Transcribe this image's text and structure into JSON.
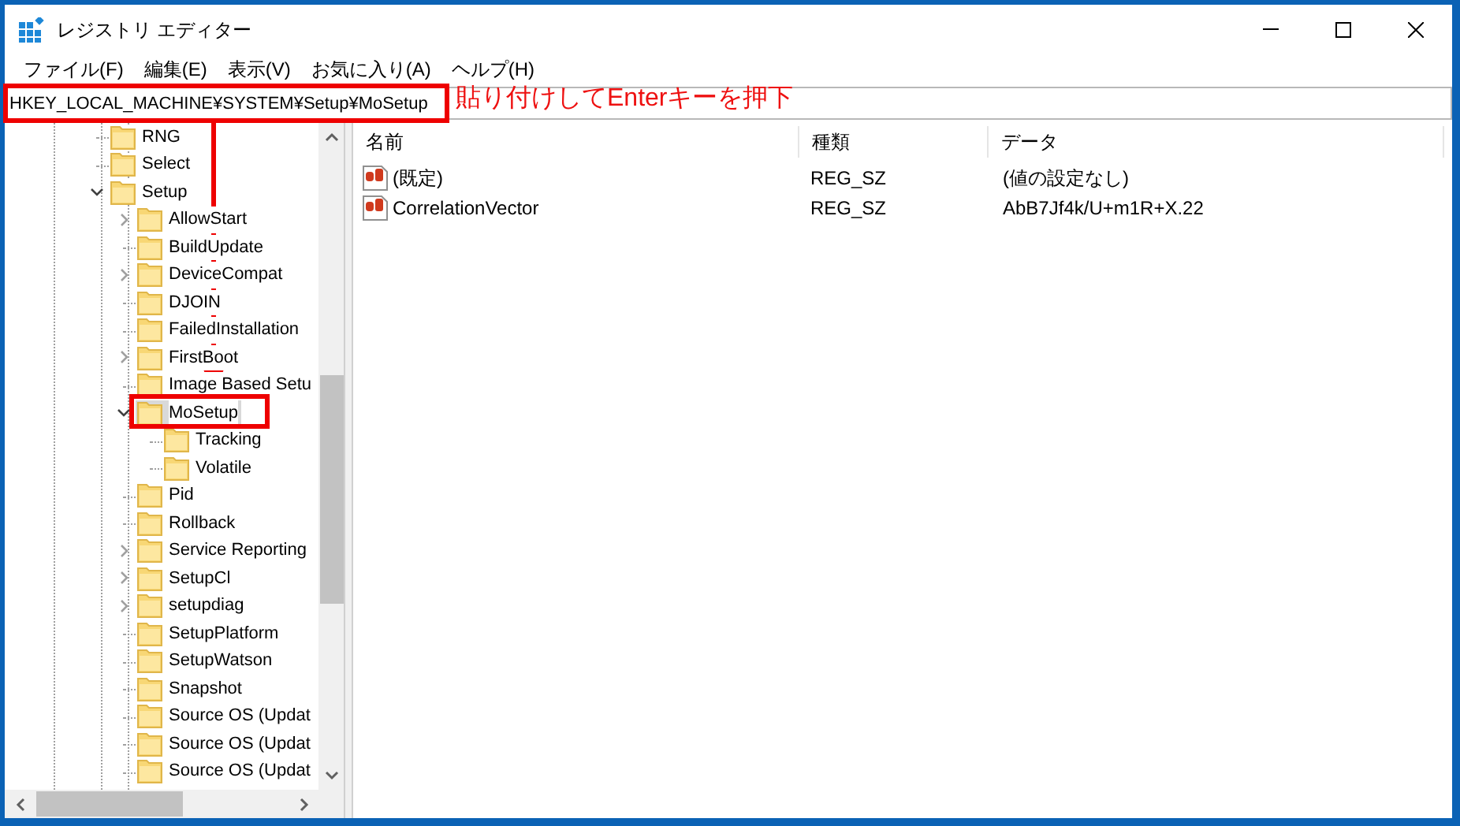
{
  "window": {
    "title": "レジストリ エディター"
  },
  "menu": [
    "ファイル(F)",
    "編集(E)",
    "表示(V)",
    "お気に入り(A)",
    "ヘルプ(H)"
  ],
  "address": "HKEY_LOCAL_MACHINE¥SYSTEM¥Setup¥MoSetup",
  "tree": [
    {
      "label": "RNG",
      "kind": "leaf",
      "selected": false
    },
    {
      "label": "Select",
      "kind": "leaf",
      "selected": false
    },
    {
      "label": "Setup",
      "kind": "expanded",
      "selected": false,
      "children": [
        {
          "label": "AllowStart",
          "kind": "collapsed",
          "selected": false
        },
        {
          "label": "BuildUpdate",
          "kind": "leaf",
          "selected": false
        },
        {
          "label": "DeviceCompat",
          "kind": "collapsed",
          "selected": false
        },
        {
          "label": "DJOIN",
          "kind": "leaf",
          "selected": false
        },
        {
          "label": "FailedInstallation",
          "kind": "leaf",
          "selected": false
        },
        {
          "label": "FirstBoot",
          "kind": "collapsed",
          "selected": false
        },
        {
          "label": "Image Based Setu",
          "kind": "leaf",
          "selected": false
        },
        {
          "label": "MoSetup",
          "kind": "expanded",
          "selected": true,
          "children": [
            {
              "label": "Tracking",
              "kind": "leaf",
              "selected": false
            },
            {
              "label": "Volatile",
              "kind": "leaf",
              "selected": false
            }
          ]
        },
        {
          "label": "Pid",
          "kind": "leaf",
          "selected": false
        },
        {
          "label": "Rollback",
          "kind": "leaf",
          "selected": false
        },
        {
          "label": "Service Reporting",
          "kind": "collapsed",
          "selected": false
        },
        {
          "label": "SetupCl",
          "kind": "collapsed",
          "selected": false
        },
        {
          "label": "setupdiag",
          "kind": "collapsed",
          "selected": false
        },
        {
          "label": "SetupPlatform",
          "kind": "leaf",
          "selected": false
        },
        {
          "label": "SetupWatson",
          "kind": "leaf",
          "selected": false
        },
        {
          "label": "Snapshot",
          "kind": "leaf",
          "selected": false
        },
        {
          "label": "Source OS (Updat",
          "kind": "leaf",
          "selected": false
        },
        {
          "label": "Source OS (Updat",
          "kind": "leaf",
          "selected": false
        },
        {
          "label": "Source OS (Updat",
          "kind": "leaf",
          "selected": false
        }
      ]
    }
  ],
  "values": {
    "columns": [
      "名前",
      "種類",
      "データ"
    ],
    "rows": [
      {
        "name": "(既定)",
        "type": "REG_SZ",
        "data": "(値の設定なし)"
      },
      {
        "name": "CorrelationVector",
        "type": "REG_SZ",
        "data": "AbB7Jf4k/U+m1R+X.22"
      }
    ]
  },
  "annotation": {
    "note": "貼り付けしてEnterキーを押下"
  }
}
